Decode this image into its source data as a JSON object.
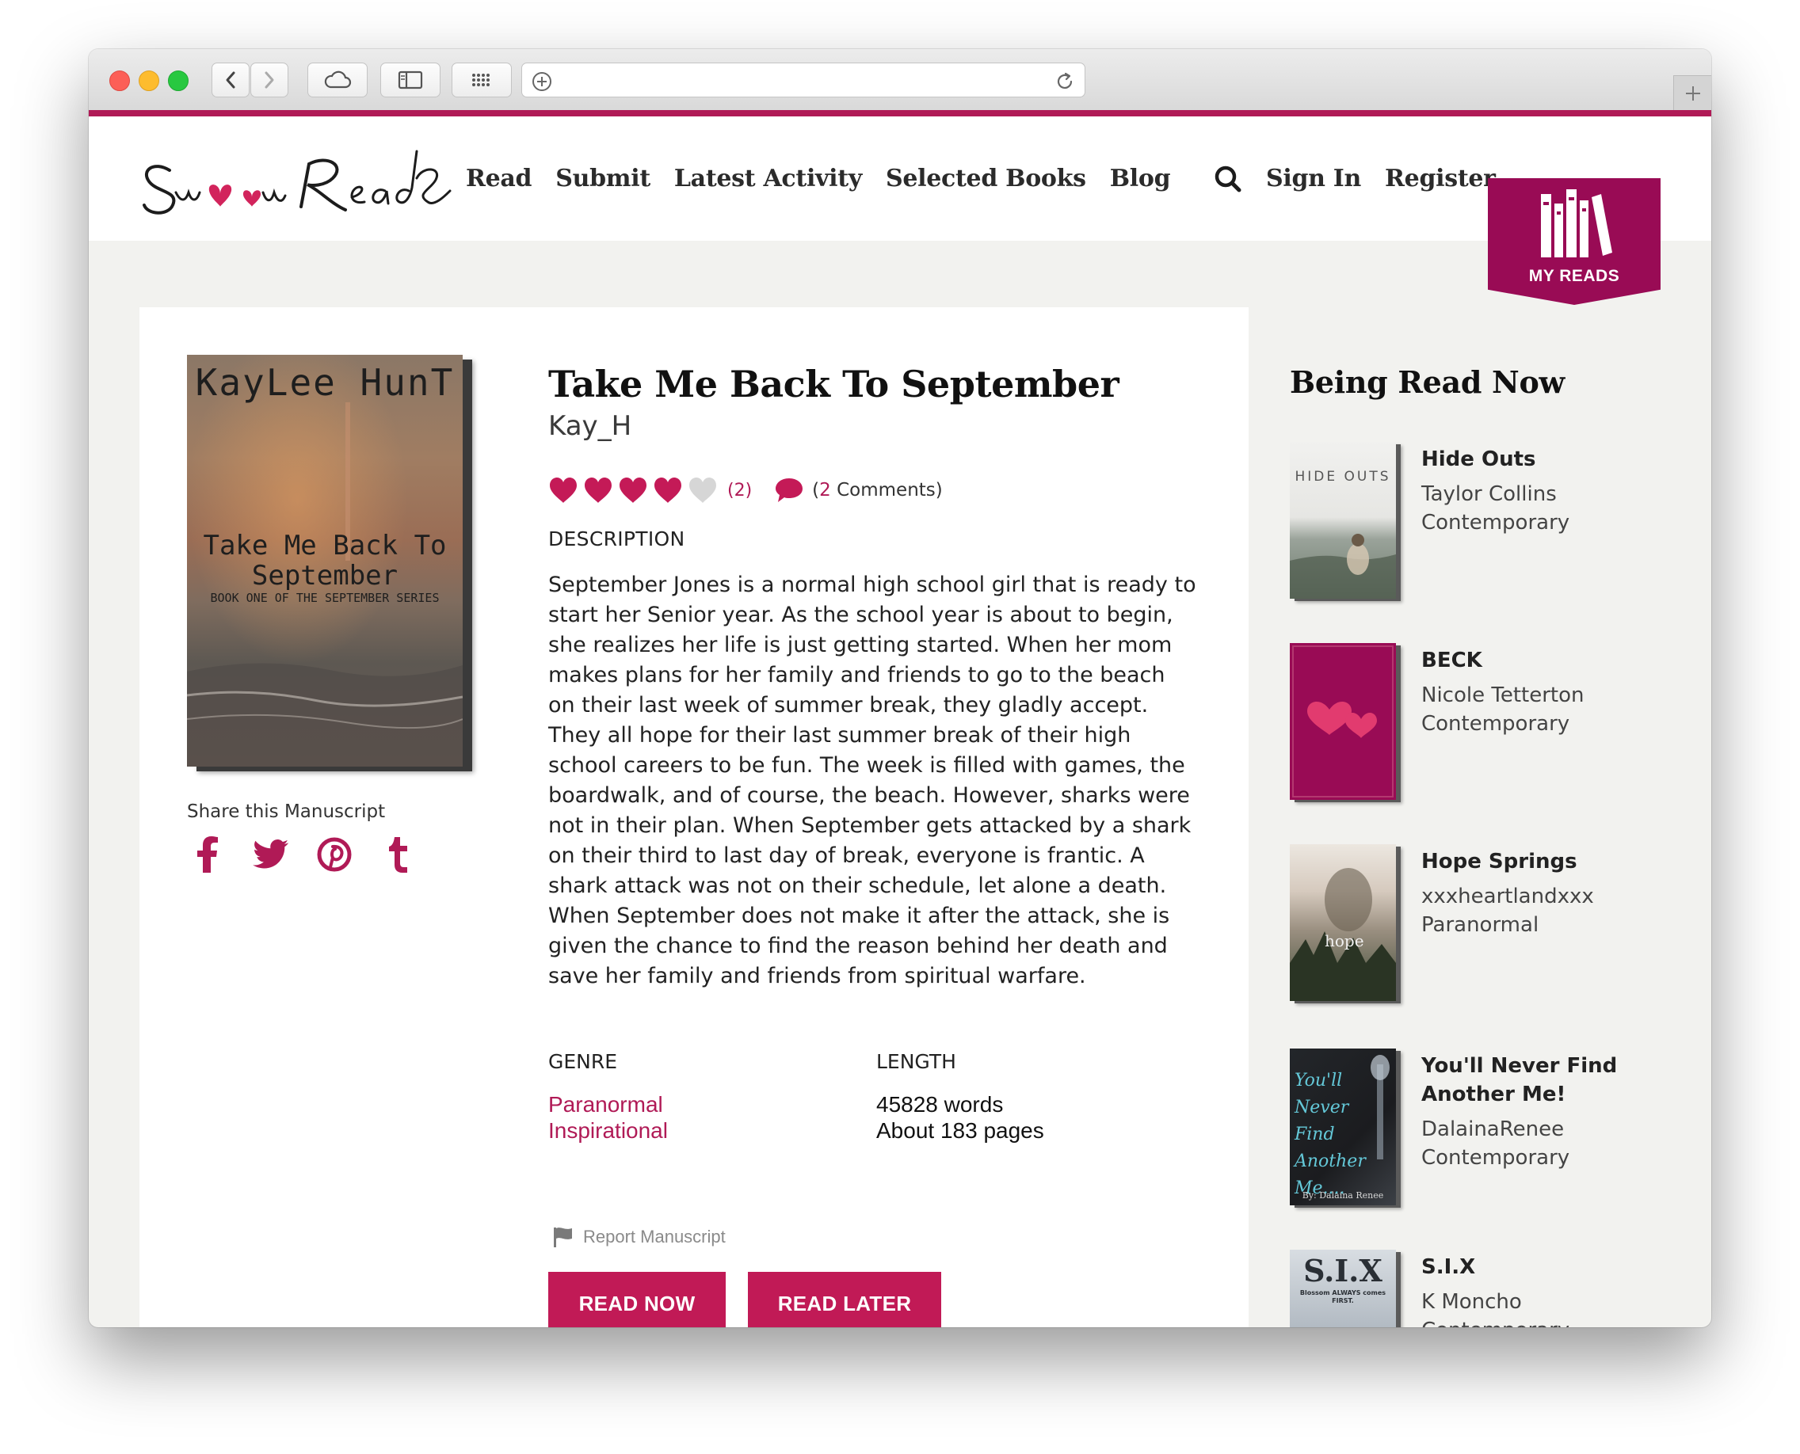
{
  "site": {
    "nav": [
      "Read",
      "Submit",
      "Latest Activity",
      "Selected Books",
      "Blog"
    ],
    "sign_in": "Sign In",
    "register": "Register",
    "my_reads": "MY READS",
    "accent": "#b01a56"
  },
  "book": {
    "title": "Take Me Back To September",
    "author": "Kay_H",
    "rating_hearts": 4,
    "rating_max": 5,
    "rating_count": "(2)",
    "comments_prefix": "(",
    "comments_count": "2",
    "comments_suffix": " Comments)",
    "description_label": "DESCRIPTION",
    "description": "September Jones is a normal high school girl that is ready to start her Senior year. As the school year is about to begin, she realizes her life is just getting started. When her mom makes plans for her family and friends to go to the beach on their last week of summer break, they gladly accept. They all hope for their last summer break of their high school careers to be fun. The week is filled with games, the boardwalk, and of course, the beach. However, sharks were not in their plan. When September gets attacked by a shark on their third to last day of break, everyone is frantic. A shark attack was not on their schedule, let alone a death. When September does not make it after the attack, she is given the chance to find the reason behind her death and save her family and friends from spiritual warfare.",
    "genre_label": "GENRE",
    "genres": [
      "Paranormal",
      "Inspirational"
    ],
    "length_label": "LENGTH",
    "words": "45828 words",
    "pages": "About 183 pages",
    "report": "Report Manuscript",
    "read_now": "READ NOW",
    "read_later": "READ LATER",
    "cover": {
      "author": "KayLee HunT",
      "title_line1": "Take Me Back To",
      "title_line2": "September",
      "series": "BOOK ONE OF THE SEPTEMBER SERIES"
    }
  },
  "share": {
    "label": "Share this Manuscript",
    "networks": [
      "facebook-icon",
      "twitter-icon",
      "pinterest-icon",
      "tumblr-icon"
    ]
  },
  "sidebar": {
    "title": "Being Read Now",
    "items": [
      {
        "title": "Hide Outs",
        "author": "Taylor Collins",
        "genre": "Contemporary",
        "cover_text": "HIDE OUTS"
      },
      {
        "title": "BECK",
        "author": "Nicole Tetterton",
        "genre": "Contemporary"
      },
      {
        "title": "Hope Springs",
        "author": "xxxheartlandxxx",
        "genre": "Paranormal",
        "cover_text": "hope"
      },
      {
        "title": "You'll Never Find Another Me!",
        "author": "DalainaRenee",
        "genre": "Contemporary",
        "cover_text": "You'll Never Find Another Me....",
        "cover_byline": "By: Dalaina Renee"
      },
      {
        "title": "S.I.X",
        "author": "K Moncho",
        "genre": "Contemporary",
        "cover_text": "S.I.X",
        "cover_tagline": "Blossom ALWAYS comes FIRST."
      }
    ]
  }
}
